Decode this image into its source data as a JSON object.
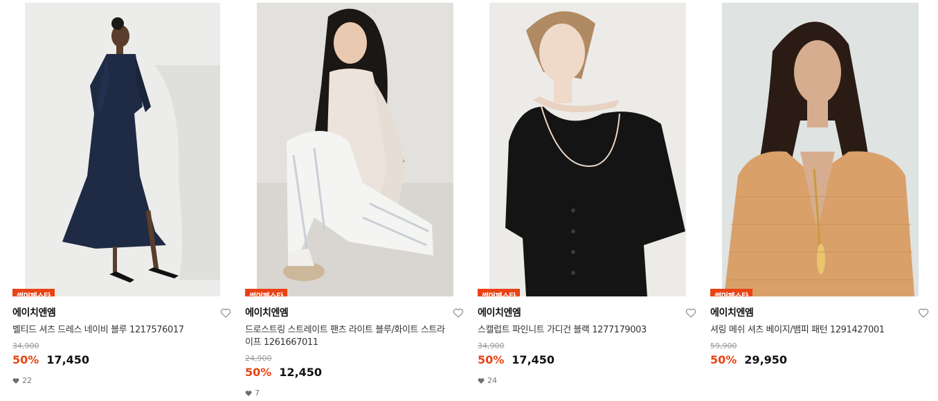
{
  "products": [
    {
      "badge": "썸머페스타",
      "brand": "에이치엔엠",
      "title": "벨티드 셔츠 드레스 네이비 블루 1217576017",
      "original_price": "34,900",
      "discount_rate": "50%",
      "sale_price": "17,450",
      "likes": "22",
      "image_icon": "photo-model-navy-shirt-dress"
    },
    {
      "badge": "썸머페스타",
      "brand": "에이치엔엠",
      "title": "드로스트링 스트레이트 팬츠 라이트 블루/화이트 스트라이프 1261667011",
      "original_price": "24,900",
      "discount_rate": "50%",
      "sale_price": "12,450",
      "likes": "7",
      "image_icon": "photo-model-striped-pants"
    },
    {
      "badge": "썸머페스타",
      "brand": "에이치엔엠",
      "title": "스캘럽트 파인니트 가디건 블랙 1277179003",
      "original_price": "34,900",
      "discount_rate": "50%",
      "sale_price": "17,450",
      "likes": "24",
      "image_icon": "photo-model-black-cardigan"
    },
    {
      "badge": "썸머페스타",
      "brand": "에이치엔엠",
      "title": "셔링 메쉬 셔츠 베이지/뱀피 패턴 1291427001",
      "original_price": "59,900",
      "discount_rate": "50%",
      "sale_price": "29,950",
      "likes": "",
      "image_icon": "photo-model-beige-mesh-shirt"
    }
  ],
  "colors": {
    "accent": "#e94315",
    "text": "#111111",
    "muted": "#9a9a9a"
  }
}
